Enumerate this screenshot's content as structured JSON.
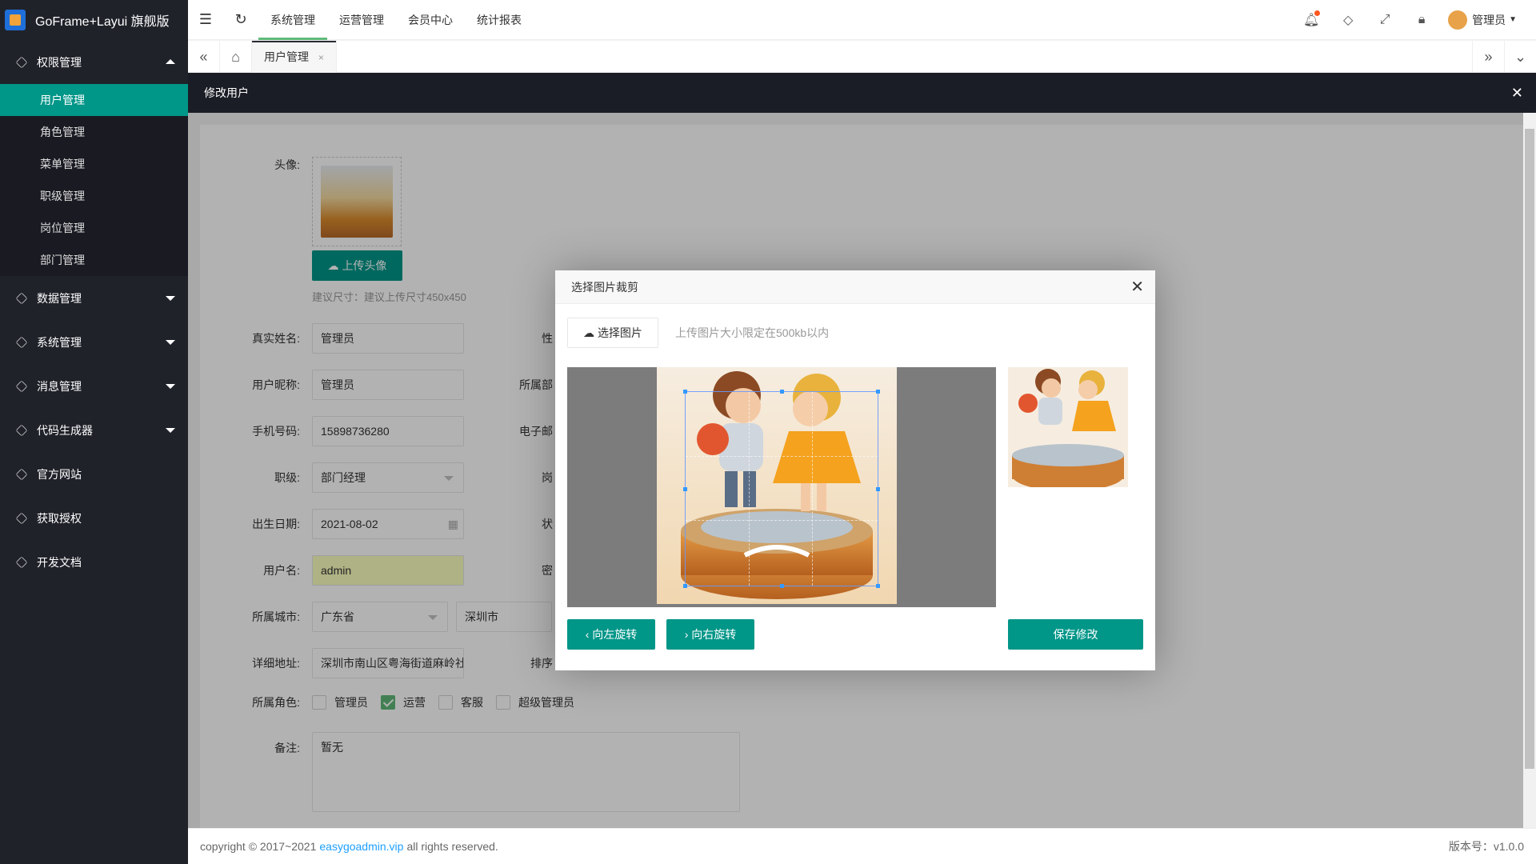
{
  "app": {
    "title": "GoFrame+Layui 旗舰版"
  },
  "sidebar": {
    "groups": [
      {
        "label": "权限管理",
        "expanded": true,
        "items": [
          "用户管理",
          "角色管理",
          "菜单管理",
          "职级管理",
          "岗位管理",
          "部门管理"
        ]
      },
      {
        "label": "数据管理"
      },
      {
        "label": "系统管理"
      },
      {
        "label": "消息管理"
      },
      {
        "label": "代码生成器"
      },
      {
        "label": "官方网站"
      },
      {
        "label": "获取授权"
      },
      {
        "label": "开发文档"
      }
    ],
    "active_item": "用户管理"
  },
  "topnav": {
    "items": [
      "系统管理",
      "运营管理",
      "会员中心",
      "统计报表"
    ],
    "active": "系统管理"
  },
  "user": {
    "name": "管理员"
  },
  "tabs": {
    "items": [
      {
        "label": "用户管理",
        "close": "×"
      }
    ]
  },
  "layer": {
    "title": "修改用户",
    "close": "✕"
  },
  "form": {
    "avatar_label": "头像:",
    "upload_btn": "上传头像",
    "size_hint": "建议尺寸：建议上传尺寸450x450",
    "realname_label": "真实姓名:",
    "realname": "管理员",
    "gender_label": "性",
    "nickname_label": "用户昵称:",
    "nickname": "管理员",
    "dept_label": "所属部",
    "phone_label": "手机号码:",
    "phone": "15898736280",
    "email_label": "电子邮",
    "level_label": "职级:",
    "level": "部门经理",
    "post_label": "岗",
    "birthday_label": "出生日期:",
    "birthday": "2021-08-02",
    "status_label": "状",
    "username_label": "用户名:",
    "username": "admin",
    "password_label": "密",
    "city_label": "所属城市:",
    "province": "广东省",
    "city": "深圳市",
    "address_label": "详细地址:",
    "address": "深圳市南山区粤海街道麻岭社",
    "sort_label": "排序",
    "roles_label": "所属角色:",
    "roles": [
      {
        "name": "管理员",
        "checked": false
      },
      {
        "name": "运营",
        "checked": true
      },
      {
        "name": "客服",
        "checked": false
      },
      {
        "name": "超级管理员",
        "checked": false
      }
    ],
    "note_label": "备注:",
    "note": "暂无"
  },
  "dialog": {
    "title": "选择图片裁剪",
    "close": "✕",
    "choose_btn": "选择图片",
    "hint": "上传图片大小限定在500kb以内",
    "rotate_left": "向左旋转",
    "rotate_right": "向右旋转",
    "save": "保存修改"
  },
  "footer": {
    "prefix": "copyright © 2017~2021",
    "link": "easygoadmin.vip",
    "suffix": "all rights reserved.",
    "version": "版本号：v1.0.0"
  },
  "colors": {
    "accent": "#009688",
    "sidebar": "#20222a",
    "header": "#1b1d26"
  }
}
